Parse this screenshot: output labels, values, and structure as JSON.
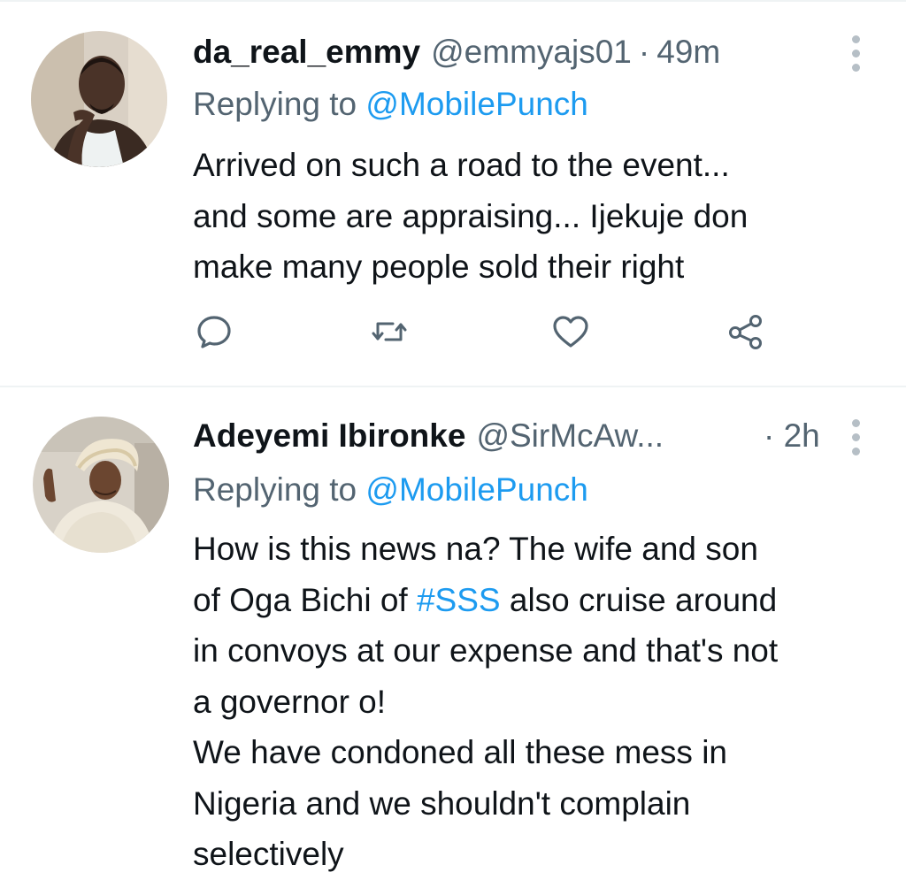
{
  "tweets": [
    {
      "display_name": "da_real_emmy",
      "handle": "@emmyajs01",
      "separator": "·",
      "time": "49m",
      "replying_prefix": "Replying to ",
      "replying_to": "@MobilePunch",
      "text_lines": [
        "Arrived on such a road to the event...",
        "and some are appraising... Ijekuje don",
        "make many people sold their right"
      ],
      "avatar_icon": "profile-photo-man-white-tank-top",
      "actions": [
        {
          "name": "reply",
          "icon": "speech-bubble-icon"
        },
        {
          "name": "retweet",
          "icon": "retweet-arrows-icon"
        },
        {
          "name": "like",
          "icon": "heart-icon"
        },
        {
          "name": "share",
          "icon": "share-nodes-icon"
        }
      ]
    },
    {
      "display_name": "Adeyemi Ibironke",
      "handle": "@SirMcAw...",
      "separator": "·",
      "time": "2h",
      "replying_prefix": "Replying to ",
      "replying_to": "@MobilePunch",
      "text_lines": [
        {
          "before": "How is this news na? The wife and son",
          "tag": "",
          "after": ""
        },
        {
          "before": "of Oga Bichi of ",
          "tag": "#SSS",
          "after": " also cruise around"
        },
        {
          "before": "in convoys at our expense and that's not",
          "tag": "",
          "after": ""
        },
        {
          "before": "a governor o!",
          "tag": "",
          "after": ""
        },
        {
          "before": "We have condoned all these mess in",
          "tag": "",
          "after": ""
        },
        {
          "before": "Nigeria and we shouldn't complain",
          "tag": "",
          "after": ""
        },
        {
          "before": "selectively",
          "tag": "",
          "after": ""
        }
      ],
      "avatar_icon": "profile-photo-woman-gele-headtie"
    }
  ],
  "colors": {
    "link": "#1d9bf0",
    "secondary_text": "#536471",
    "primary_text": "#0f1419",
    "divider": "#eff3f4",
    "more_dots": "#b6bfc6"
  }
}
